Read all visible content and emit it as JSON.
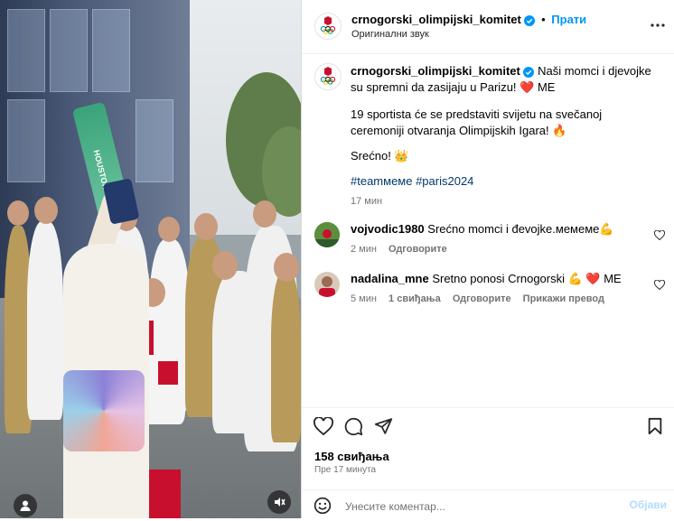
{
  "media": {
    "banner_text": "HOUSTON",
    "user_icon": "user-tag-icon",
    "mute_icon": "audio-muted-icon"
  },
  "header": {
    "username": "crnogorski_olimpijski_komitet",
    "verified": true,
    "separator": "•",
    "follow_label": "Прати",
    "audio_label": "Оригинални звук",
    "more_icon": "more-options-icon"
  },
  "caption": {
    "username": "crnogorski_olimpijski_komitet",
    "line1": " Naši momci i djevojke su spremni da zasijaju u Parizu! ❤️ ME",
    "line2": "19 sportista će se predstaviti svijetu na svečanoj ceremoniji otvaranja Olimpijskih Igara! 🔥",
    "line3": "Srećno! 👑",
    "hashtags": "#teamмеме #paris2024",
    "time": "17 мин"
  },
  "comments": [
    {
      "username": "vojvodic1980",
      "text": " Srećno momci i đevojke.мемеме💪",
      "time": "2 мин",
      "reply_label": "Одговорите"
    },
    {
      "username": "nadalina_mne",
      "text": " Sretno ponosi Crnogorski 💪 ❤️ ME",
      "time": "5 мин",
      "likes_label": "1 свиђања",
      "reply_label": "Одговорите",
      "translate_label": "Прикажи превод"
    }
  ],
  "actions": {
    "likes": "158 свиђања",
    "ago": "Пре 17 минута",
    "comment_placeholder": "Унесите коментар...",
    "post_label": "Објави"
  },
  "colors": {
    "accent": "#0095f6",
    "secondary_text": "#737373",
    "hashtag": "#00376b",
    "verified": "#0095f6",
    "heart": "#ed4956"
  }
}
